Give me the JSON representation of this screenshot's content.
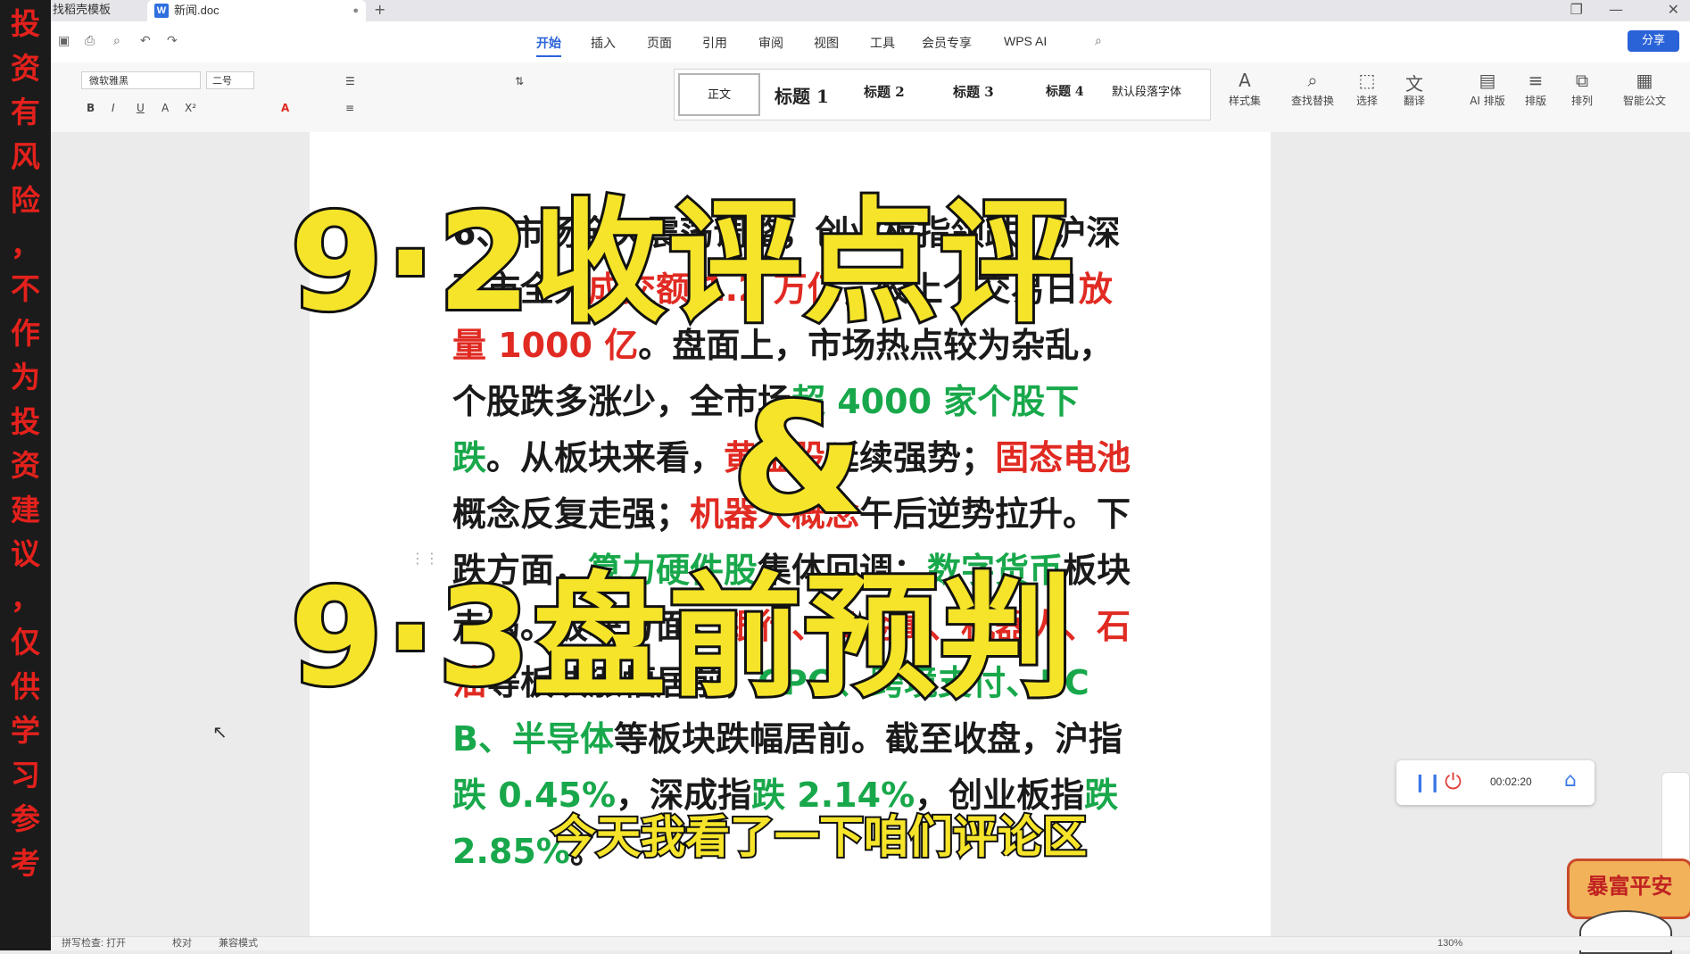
{
  "left_banner": {
    "chars": [
      "投",
      "资",
      "有",
      "风",
      "险",
      "，",
      "不",
      "作",
      "为",
      "投",
      "资",
      "建",
      "议",
      "，",
      "仅",
      "供",
      "学",
      "习",
      "参",
      "考"
    ]
  },
  "tabs": {
    "inactive_label": "找稻壳模板",
    "active_label": "新闻.doc",
    "doc_icon_letter": "W",
    "dot": "●",
    "new_tab": "+"
  },
  "window": {
    "restore_icon": "❐",
    "minimize_icon": "—",
    "close_icon": "✕"
  },
  "menu": {
    "items": [
      "开始",
      "插入",
      "页面",
      "引用",
      "审阅",
      "视图",
      "工具",
      "会员专享",
      "WPS AI"
    ],
    "active_index": 0,
    "share_label": "分享"
  },
  "ribbon": {
    "font_name": "微软雅黑",
    "font_size": "二号",
    "styles": [
      "正文",
      "标题 1",
      "标题 2",
      "标题 3",
      "标题 4",
      "默认段落字体"
    ],
    "tools": [
      {
        "label": "样式集",
        "glyph": "A"
      },
      {
        "label": "查找替换",
        "glyph": "⌕"
      },
      {
        "label": "选择",
        "glyph": "⬚"
      },
      {
        "label": "翻译",
        "glyph": "文"
      },
      {
        "label": "AI 排版",
        "glyph": "▤"
      },
      {
        "label": "排版",
        "glyph": "≡"
      },
      {
        "label": "排列",
        "glyph": "⧉"
      },
      {
        "label": "智能公文",
        "glyph": "▦"
      }
    ],
    "format_buttons": [
      "B",
      "I",
      "U",
      "A",
      "X²",
      "A"
    ]
  },
  "document": {
    "seg": [
      "6、市场全天震荡调整，创业板指领跌。沪深两市全天",
      "成交额 1.2 万亿",
      "，较上个交易日",
      "放量 1000 亿",
      "。盘面上，市场热点较为杂乱，个股跌多涨少，全市场",
      "超 4000 家个股下跌",
      "。从板块来看，",
      "黄金股",
      "延续强势；",
      "固态电池",
      "概念反复走强；",
      "机器人概念",
      "午后逆势拉升。下跌方面，",
      "算力硬件股",
      "集体回调；",
      "数字货币",
      "板块走弱。板块方面，",
      "银行、贵金属、机器人、石油",
      "等板块涨幅居前，",
      "CPO、跨境支付、PCB、半导体",
      "等板块跌幅居前。截至收盘，沪指",
      "跌 0.45%",
      "，深成指",
      "跌 2.14%",
      "，创业板指",
      "跌 2.85%",
      "。"
    ]
  },
  "overlay": {
    "line1": "9·2收评点评",
    "line2": "&",
    "line3": "9·3盘前预判",
    "subtitle": "今天我看了一下咱们评论区"
  },
  "recorder": {
    "time": "00:02:20",
    "pause_icon": "❙❙",
    "power_icon": "⏻",
    "home_icon": "⌂"
  },
  "stamp": {
    "text": "暴富平安"
  },
  "statusbar": {
    "items": [
      "拼写检查: 打开",
      "校对",
      "兼容模式"
    ],
    "zoom": "130%"
  },
  "colors": {
    "accent": "#2a62d8",
    "red_text": "#e02a22",
    "green_text": "#18a84b",
    "overlay_yellow": "#f5e42a"
  }
}
